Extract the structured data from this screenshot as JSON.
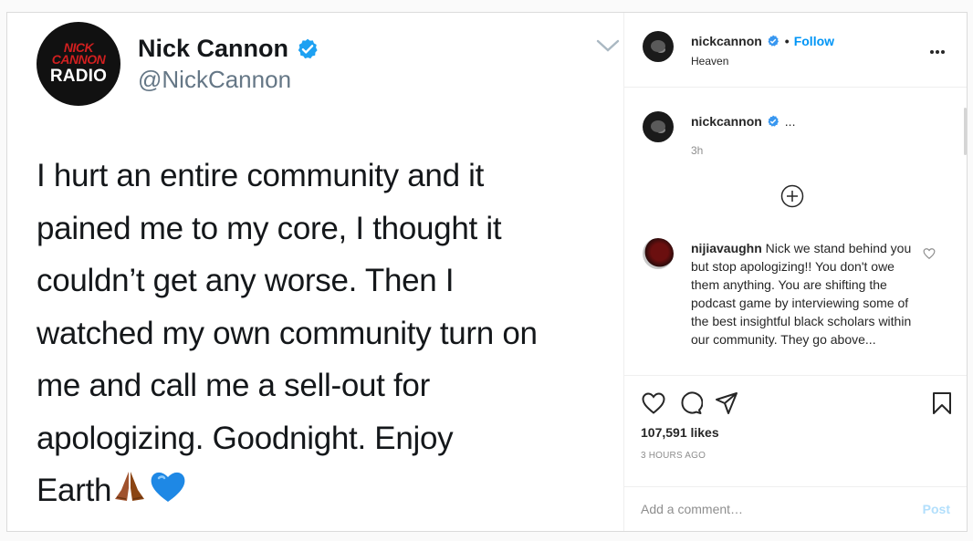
{
  "tweet": {
    "logo_top": "NICK\nCANNON",
    "logo_bottom": "RADIO",
    "name": "Nick Cannon",
    "handle": "@NickCannon",
    "lines": [
      "I hurt an entire community and it",
      "pained me to my core, I thought it",
      "couldn’t get any worse. Then I",
      "watched my own community turn on",
      "me and call me a sell-out for",
      "apologizing. Goodnight. Enjoy",
      "Earth"
    ],
    "emoji_1": "praying-hands",
    "emoji_2": "blue-heart"
  },
  "header": {
    "username": "nickcannon",
    "dot": "•",
    "follow_label": "Follow",
    "location": "Heaven"
  },
  "caption": {
    "username": "nickcannon",
    "ellipsis": "...",
    "time": "3h"
  },
  "comment": {
    "username": "nijiavaughn",
    "text": " Nick we stand behind you but stop apologizing!! You don't owe them anything. You are shifting the podcast game by interviewing some of the best insightful black scholars within our community. They go above... "
  },
  "stats": {
    "likes": "107,591 likes",
    "time_ago": "3 HOURS AGO"
  },
  "composer": {
    "placeholder": "Add a comment…",
    "post_label": "Post"
  },
  "colors": {
    "accent": "#0095f6",
    "verified": "#3897f0",
    "tweet_verified": "#1da1f2"
  }
}
